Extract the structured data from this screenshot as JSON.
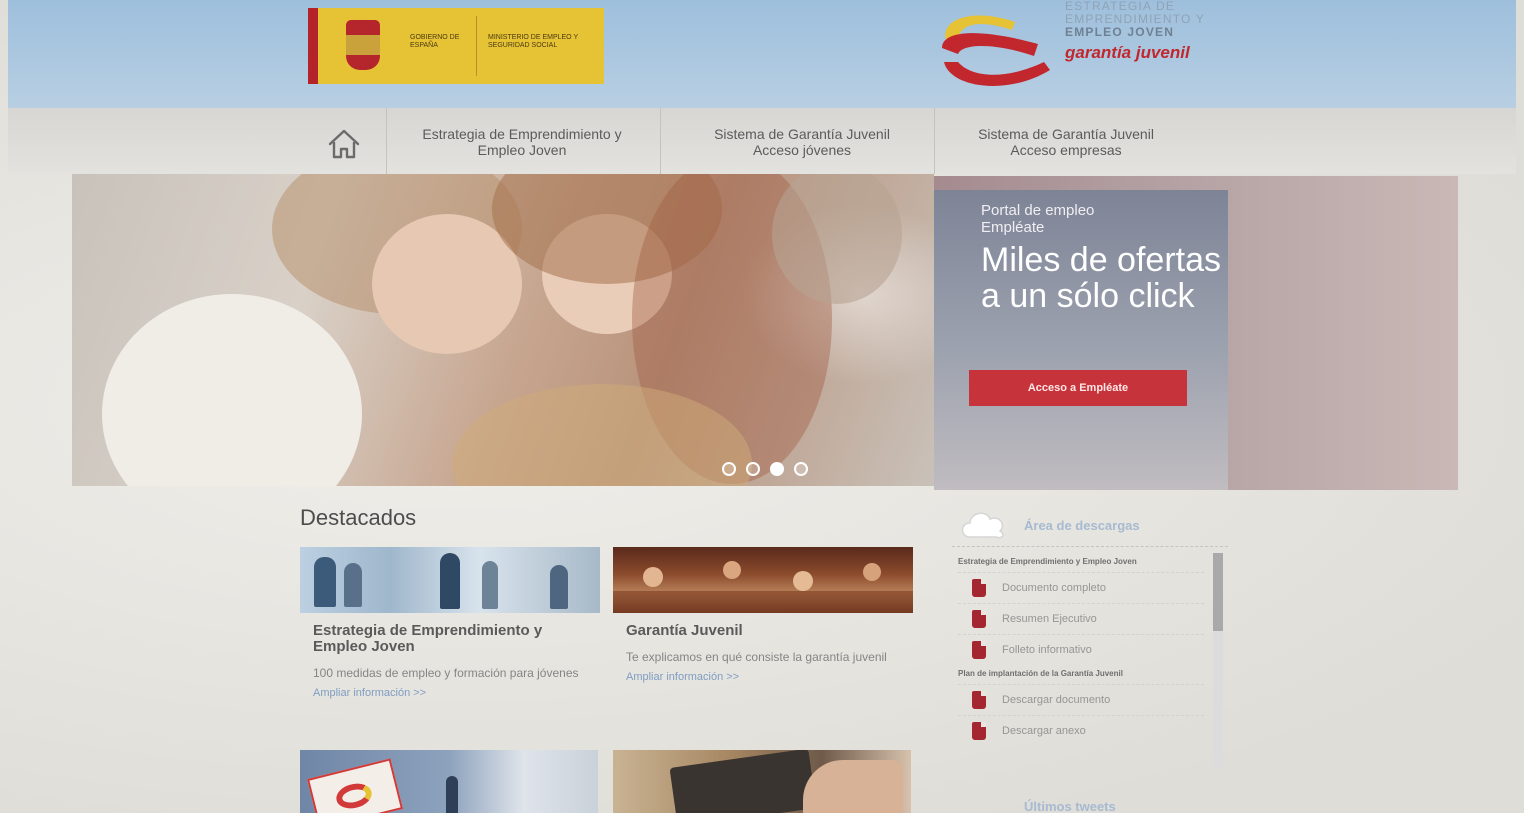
{
  "header": {
    "gov_logo": {
      "gobierno": "GOBIERNO DE ESPAÑA",
      "ministerio": "MINISTERIO DE EMPLEO Y SEGURIDAD SOCIAL"
    },
    "brand": {
      "line1": "ESTRATEGIA DE",
      "line2": "EMPRENDIMIENTO Y",
      "line3": "EMPLEO JOVEN",
      "tagline": "garantía juvenil",
      "colors": {
        "red": "#c1272d",
        "yellow": "#e6c235"
      }
    }
  },
  "nav": {
    "home_icon": "home-icon",
    "items": [
      {
        "line1": "Estrategia de Emprendimiento y",
        "line2": "Empleo Joven"
      },
      {
        "line1": "Sistema de Garantía Juvenil",
        "line2": "Acceso jóvenes"
      },
      {
        "line1": "Sistema de Garantía Juvenil",
        "line2": "Acceso empresas"
      }
    ]
  },
  "hero": {
    "slides": 4,
    "active_slide": 3
  },
  "promo": {
    "kicker_line1": "Portal de empleo",
    "kicker_line2": "Empléate",
    "title": "Miles de ofertas a un sólo click",
    "button": "Acceso a Empléate",
    "button_color": "#c7333a"
  },
  "featured": {
    "title": "Destacados",
    "cards": [
      {
        "title": "Estrategia de Emprendimiento y Empleo Joven",
        "text": "100 medidas de empleo y formación para jóvenes",
        "link": "Ampliar información >>"
      },
      {
        "title": "Garantía Juvenil",
        "text": "Te explicamos en qué consiste la garantía juvenil",
        "link": "Ampliar información >>"
      }
    ]
  },
  "downloads": {
    "title": "Área de descargas",
    "icon": "cloud-icon",
    "groups": [
      {
        "title": "Estrategia de Emprendimiento y Empleo Joven",
        "items": [
          "Documento completo",
          "Resumen Ejecutivo",
          "Folleto informativo"
        ]
      },
      {
        "title": "Plan de implantación de la Garantía Juvenil",
        "items": [
          "Descargar documento",
          "Descargar anexo"
        ]
      }
    ],
    "tweets_title": "Últimos tweets"
  }
}
